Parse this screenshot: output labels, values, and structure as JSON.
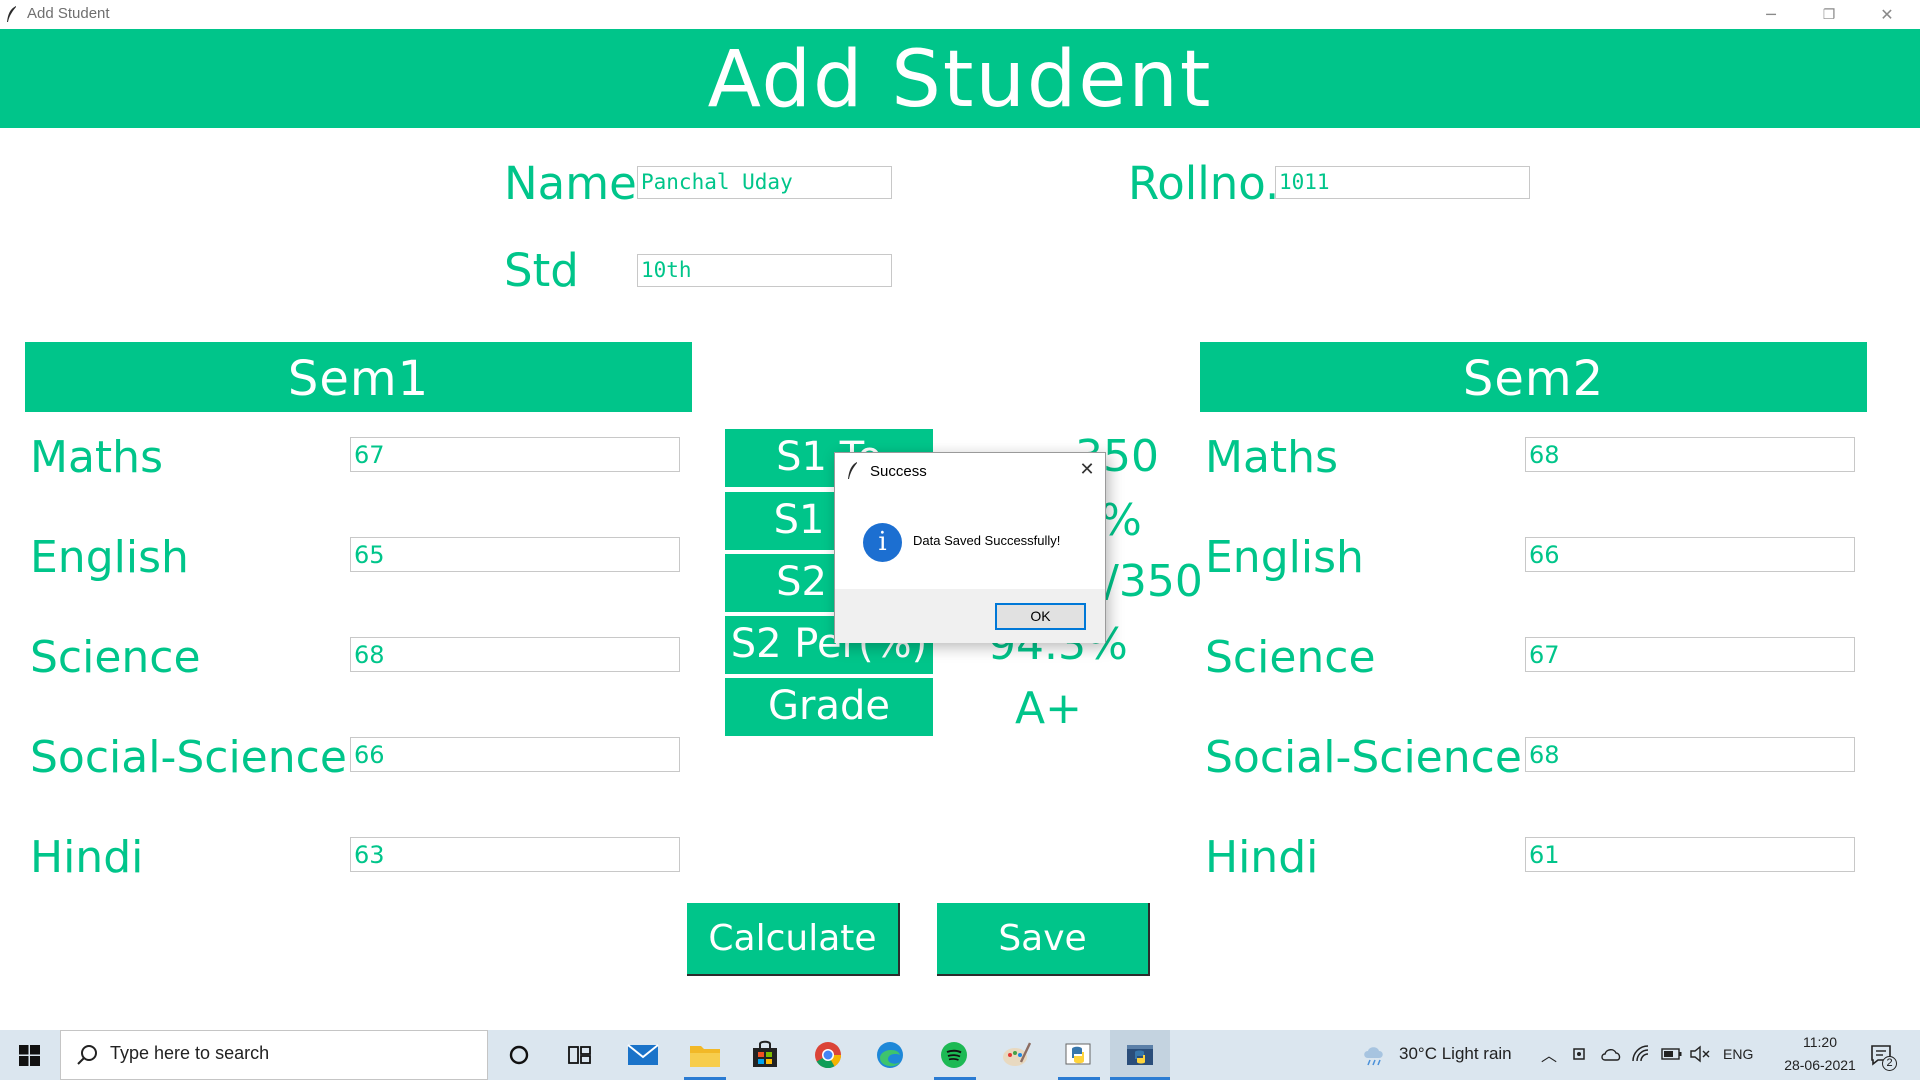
{
  "window": {
    "title": "Add Student",
    "minimize": "─",
    "restore": "❐",
    "close": "✕"
  },
  "header": {
    "title": "Add Student"
  },
  "student": {
    "name_label": "Name",
    "name_value": "Panchal Uday",
    "rollno_label": "Rollno.",
    "rollno_value": "1011",
    "std_label": "Std",
    "std_value": "10th"
  },
  "sem1": {
    "title": "Sem1",
    "subjects": [
      {
        "label": "Maths",
        "value": "67"
      },
      {
        "label": "English",
        "value": "65"
      },
      {
        "label": "Science",
        "value": "68"
      },
      {
        "label": "Social-Science",
        "value": "66"
      },
      {
        "label": "Hindi",
        "value": "63"
      }
    ]
  },
  "sem2": {
    "title": "Sem2",
    "subjects": [
      {
        "label": "Maths",
        "value": "68"
      },
      {
        "label": "English",
        "value": "66"
      },
      {
        "label": "Science",
        "value": "67"
      },
      {
        "label": "Social-Science",
        "value": "68"
      },
      {
        "label": "Hindi",
        "value": "61"
      }
    ]
  },
  "results": {
    "s1_total_label": "S1 To",
    "s1_total_value": "350",
    "s1_per_label": "S1 Pe",
    "s1_per_value": "%",
    "s2_total_label": "S2 To",
    "s2_total_value": "/350",
    "s2_per_label": "S2 Per(%)",
    "s2_per_value": "94.3%",
    "grade_label": "Grade",
    "grade_value": "A+"
  },
  "actions": {
    "calculate": "Calculate",
    "save": "Save"
  },
  "dialog": {
    "title": "Success",
    "message": "Data Saved Successfully!",
    "ok": "OK",
    "close": "✕",
    "info_glyph": "i"
  },
  "taskbar": {
    "search_placeholder": "Type here to search",
    "weather": "30°C  Light rain",
    "language": "ENG",
    "time": "11:20",
    "date": "28-06-2021",
    "notification_count": "2",
    "icons": [
      "windows-start-icon",
      "search-icon",
      "cortana-icon",
      "task-view-icon",
      "mail-icon",
      "file-explorer-icon",
      "store-icon",
      "chrome-icon",
      "edge-icon",
      "spotify-icon",
      "paint-icon",
      "python-idle-icon",
      "python-app-icon"
    ]
  },
  "colors": {
    "accent": "#00c58a",
    "dialog_ok_border": "#0078d7",
    "info_icon": "#1c6fd1",
    "taskbar_bg": "#dbe6ef"
  }
}
